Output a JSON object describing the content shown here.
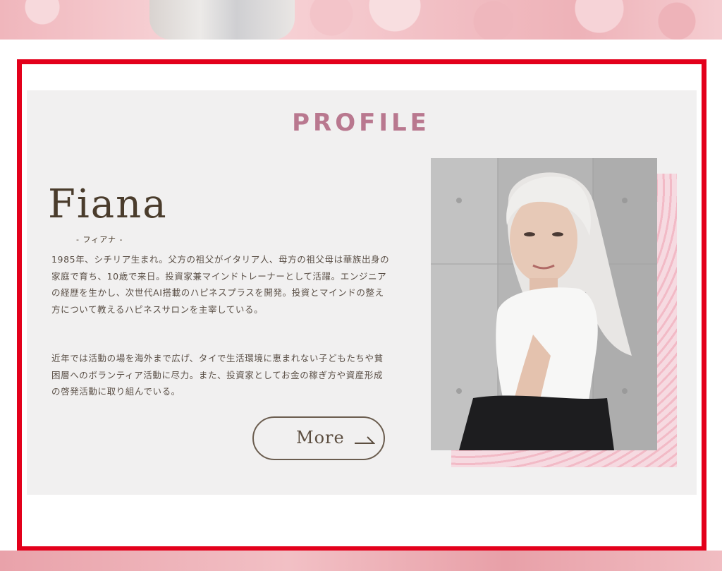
{
  "section": {
    "title": "PROFILE"
  },
  "profile": {
    "name_en": "Fiana",
    "name_kana": "- フィアナ -",
    "bio_paragraphs": [
      "1985年、シチリア生まれ。父方の祖父がイタリア人、母方の祖父母は華族出身の家庭で育ち、10歳で来日。投資家兼マインドトレーナーとして活躍。エンジニアの経歴を生かし、次世代AI搭載のハピネスプラスを開発。投資とマインドの整え方について教えるハピネスサロンを主宰している。",
      "近年では活動の場を海外まで広げ、タイで生活環境に恵まれない子どもたちや貧困層へのボランティア活動に尽力。また、投資家としてお金の稼ぎ方や資産形成の啓発活動に取り組んでいる。"
    ],
    "more_button_label": "More",
    "photo_icon": "portrait-photo"
  },
  "colors": {
    "title": "#b9788f",
    "name": "#4a3c2c",
    "frame_highlight": "#e3001b",
    "panel_bg": "#f1f0f0"
  }
}
